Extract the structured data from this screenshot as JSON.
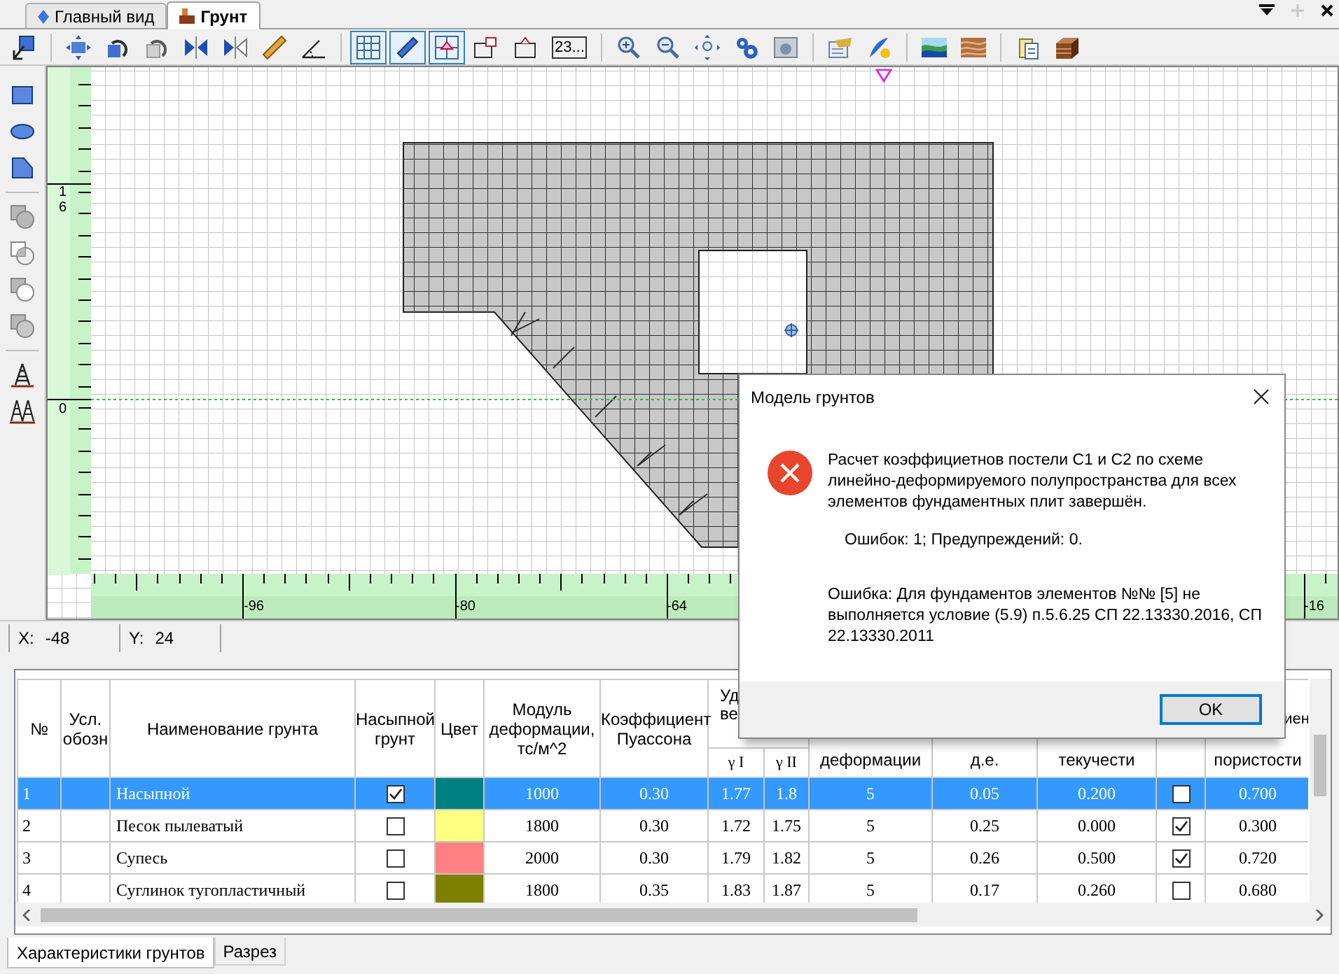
{
  "tabs": [
    {
      "label": "Главный вид",
      "selected": false,
      "kind": "view"
    },
    {
      "label": "Грунт",
      "selected": true,
      "kind": "soil"
    }
  ],
  "toolbar": {
    "groups": [
      [
        {
          "kind": "pointer",
          "pressed": false
        }
      ],
      [
        {
          "kind": "move",
          "pressed": false
        },
        {
          "kind": "rotate",
          "pressed": false
        },
        {
          "kind": "rotate_gray",
          "pressed": false
        },
        {
          "kind": "mirror",
          "pressed": false
        },
        {
          "kind": "mirror_gray",
          "pressed": false
        },
        {
          "kind": "ruler",
          "pressed": false
        },
        {
          "kind": "angle",
          "pressed": false
        }
      ],
      [
        {
          "kind": "grid",
          "pressed": true
        },
        {
          "kind": "measure",
          "pressed": true
        },
        {
          "kind": "snap",
          "pressed": true
        },
        {
          "kind": "add_box",
          "pressed": false
        },
        {
          "kind": "attach",
          "pressed": false
        },
        {
          "kind": "counter",
          "label": "23...",
          "pressed": false
        }
      ],
      [
        {
          "kind": "zoom_in",
          "pressed": false
        },
        {
          "kind": "zoom_out",
          "pressed": false
        },
        {
          "kind": "pan",
          "pressed": false
        },
        {
          "kind": "gears",
          "pressed": false
        },
        {
          "kind": "camera",
          "pressed": false
        }
      ],
      [
        {
          "kind": "card",
          "pressed": false
        },
        {
          "kind": "feather",
          "pressed": false
        }
      ],
      [
        {
          "kind": "waves",
          "pressed": false
        },
        {
          "kind": "layers",
          "pressed": false
        }
      ],
      [
        {
          "kind": "clipboard",
          "pressed": false
        },
        {
          "kind": "box",
          "pressed": false
        }
      ]
    ]
  },
  "side_toolbar": [
    [
      {
        "kind": "rectangle"
      },
      {
        "kind": "ellipse"
      },
      {
        "kind": "polygon"
      }
    ],
    [
      {
        "kind": "union"
      },
      {
        "kind": "intersect"
      },
      {
        "kind": "subtract"
      },
      {
        "kind": "xor"
      }
    ],
    [
      {
        "kind": "tower"
      },
      {
        "kind": "towers"
      }
    ]
  ],
  "canvas": {
    "vertical_ruler": [
      "16",
      "0"
    ],
    "horizontal_ruler": [
      "-96",
      "-80",
      "-64",
      "-16"
    ]
  },
  "status_bar": [
    {
      "label": "X:",
      "value": "-48"
    },
    {
      "label": "Y:",
      "value": "24"
    }
  ],
  "table": {
    "columns": [
      {
        "kind": "plain",
        "label": "№"
      },
      {
        "kind": "plain",
        "label": "Усл. обозн"
      },
      {
        "kind": "plain",
        "label": "Наименование грунта"
      },
      {
        "kind": "plain",
        "label": "Насыпной грунт"
      },
      {
        "kind": "plain",
        "label": "Цвет"
      },
      {
        "kind": "plain",
        "label": "Модуль деформации, тс/м^2"
      },
      {
        "kind": "plain",
        "label": "Коэффициент Пуассона"
      },
      {
        "kind": "group",
        "lines": [
          "Уд",
          "ве"
        ],
        "colspan": 2,
        "subcolumns": [
          "γ I",
          "γ II"
        ]
      },
      {
        "kind": "covered",
        "label": "деформации"
      },
      {
        "kind": "covered",
        "label": "д.е."
      },
      {
        "kind": "covered",
        "label": "текучести"
      },
      {
        "kind": "covered"
      },
      {
        "kind": "covered",
        "label": "пористости",
        "tail": "иен"
      }
    ],
    "rows": [
      {
        "selected": true,
        "cells": [
          "1",
          "",
          "Насыпной",
          {
            "kind": "checkbox",
            "checked": true
          },
          {
            "kind": "color",
            "color": "#008080"
          },
          "1000",
          "0.30",
          "1.77",
          "1.8",
          "5",
          "0.05",
          "0.200",
          {
            "kind": "checkbox",
            "checked": false
          },
          "0.700"
        ]
      },
      {
        "selected": false,
        "cells": [
          "2",
          "",
          "Песок пылеватый",
          {
            "kind": "checkbox",
            "checked": false
          },
          {
            "kind": "color",
            "color": "#ffff80"
          },
          "1800",
          "0.30",
          "1.72",
          "1.75",
          "5",
          "0.25",
          "0.000",
          {
            "kind": "checkbox",
            "checked": true
          },
          "0.300"
        ]
      },
      {
        "selected": false,
        "cells": [
          "3",
          "",
          "Супесь",
          {
            "kind": "checkbox",
            "checked": false
          },
          {
            "kind": "color",
            "color": "#ff8080"
          },
          "2000",
          "0.30",
          "1.79",
          "1.82",
          "5",
          "0.26",
          "0.500",
          {
            "kind": "checkbox",
            "checked": true
          },
          "0.720"
        ]
      },
      {
        "selected": false,
        "cells": [
          "4",
          "",
          "Суглинок тугопластичный",
          {
            "kind": "checkbox",
            "checked": false
          },
          {
            "kind": "color",
            "color": "#808000"
          },
          "1800",
          "0.35",
          "1.83",
          "1.87",
          "5",
          "0.17",
          "0.260",
          {
            "kind": "checkbox",
            "checked": false
          },
          "0.680"
        ]
      }
    ]
  },
  "bottom_tabs": [
    {
      "label": "Характеристики грунтов",
      "selected": true
    },
    {
      "label": "Разрез",
      "selected": false
    }
  ],
  "dialog": {
    "title": "Модель грунтов",
    "message": "Расчет коэффициетнов постели С1 и С2 по схеме линейно-деформируемого полупространства для всех элементов фундаментных плит завершён.",
    "summary": "Ошибок: 1; Предупреждений: 0.",
    "error": "Ошибка: Для фундаментов элементов №№ [5] не выполняется условие (5.9) п.5.6.25 СП 22.13330.2016, СП 22.13330.2011",
    "button": "OK"
  }
}
